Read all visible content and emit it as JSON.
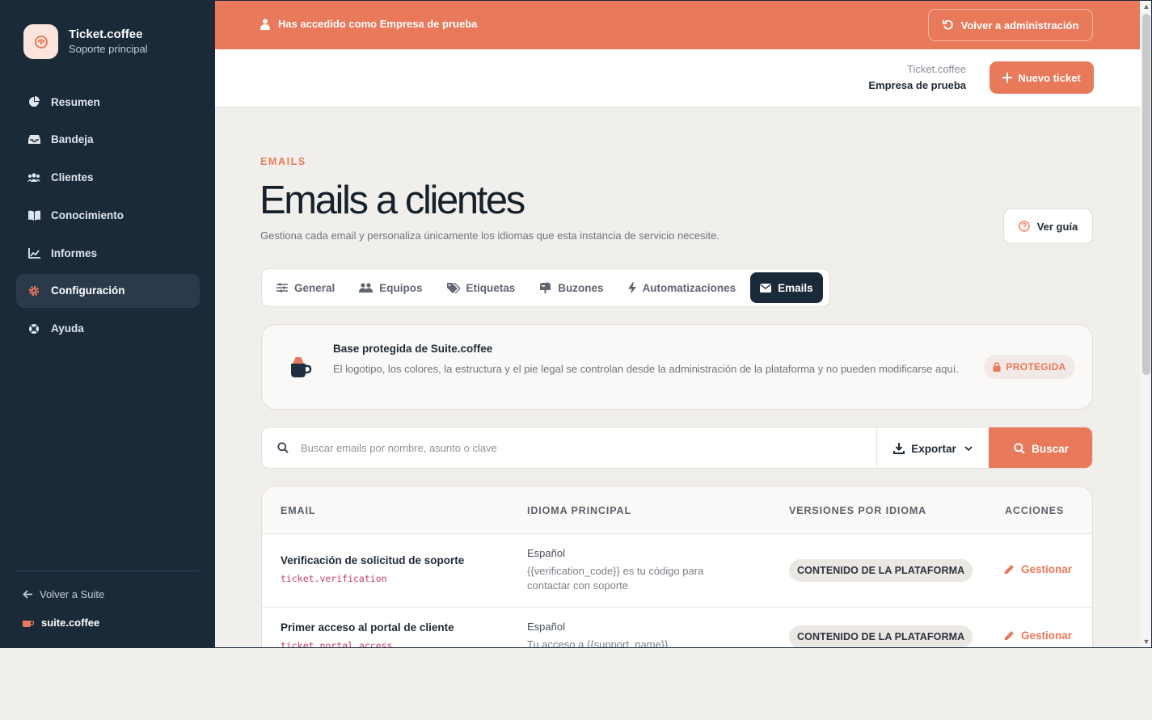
{
  "sidebar": {
    "brand_name": "Ticket.coffee",
    "brand_sub": "Soporte principal",
    "items": [
      {
        "label": "Resumen",
        "icon": "pie-chart-icon"
      },
      {
        "label": "Bandeja",
        "icon": "inbox-icon"
      },
      {
        "label": "Clientes",
        "icon": "users-icon"
      },
      {
        "label": "Conocimiento",
        "icon": "book-icon"
      },
      {
        "label": "Informes",
        "icon": "chart-icon"
      },
      {
        "label": "Configuración",
        "icon": "gear-icon",
        "active": true
      },
      {
        "label": "Ayuda",
        "icon": "lifebuoy-icon"
      }
    ],
    "back_label": "Volver a Suite",
    "suite_brand": "suite.coffee"
  },
  "banner": {
    "text": "Has accedido como Empresa de prueba",
    "back_button": "Volver a administración"
  },
  "topbar": {
    "org_sup": "Ticket.coffee",
    "org_name": "Empresa de prueba",
    "new_ticket": "Nuevo ticket"
  },
  "page": {
    "eyebrow": "EMAILS",
    "title": "Emails a clientes",
    "description": "Gestiona cada email y personaliza únicamente los idiomas que esta instancia de servicio necesite.",
    "guide_button": "Ver guía"
  },
  "tabs": [
    {
      "label": "General",
      "icon": "sliders-icon"
    },
    {
      "label": "Equipos",
      "icon": "team-icon"
    },
    {
      "label": "Etiquetas",
      "icon": "tag-icon"
    },
    {
      "label": "Buzones",
      "icon": "mailbox-icon"
    },
    {
      "label": "Automatizaciones",
      "icon": "bolt-icon"
    },
    {
      "label": "Emails",
      "icon": "envelope-icon",
      "active": true
    }
  ],
  "protected": {
    "title": "Base protegida de Suite.coffee",
    "description": "El logotipo, los colores, la estructura y el pie legal se controlan desde la administración de la plataforma y no pueden modificarse aquí.",
    "badge": "PROTEGIDA"
  },
  "search": {
    "placeholder": "Buscar emails por nombre, asunto o clave",
    "export": "Exportar",
    "button": "Buscar"
  },
  "table": {
    "headers": [
      "EMAIL",
      "IDIOMA PRINCIPAL",
      "VERSIONES POR IDIOMA",
      "ACCIONES"
    ],
    "rows": [
      {
        "name": "Verificación de solicitud de soporte",
        "key": "ticket.verification",
        "lang": "Español",
        "preview": "{{verification_code}} es tu código para contactar con soporte",
        "versions": "CONTENIDO DE LA PLATAFORMA",
        "action": "Gestionar"
      },
      {
        "name": "Primer acceso al portal de cliente",
        "key": "ticket.portal_access",
        "lang": "Español",
        "preview": "Tu acceso a {{support_name}}",
        "versions": "CONTENIDO DE LA PLATAFORMA",
        "action": "Gestionar"
      }
    ]
  },
  "colors": {
    "accent": "#e8795a",
    "sidebar": "#1b2a39",
    "background": "#f1efeb"
  }
}
